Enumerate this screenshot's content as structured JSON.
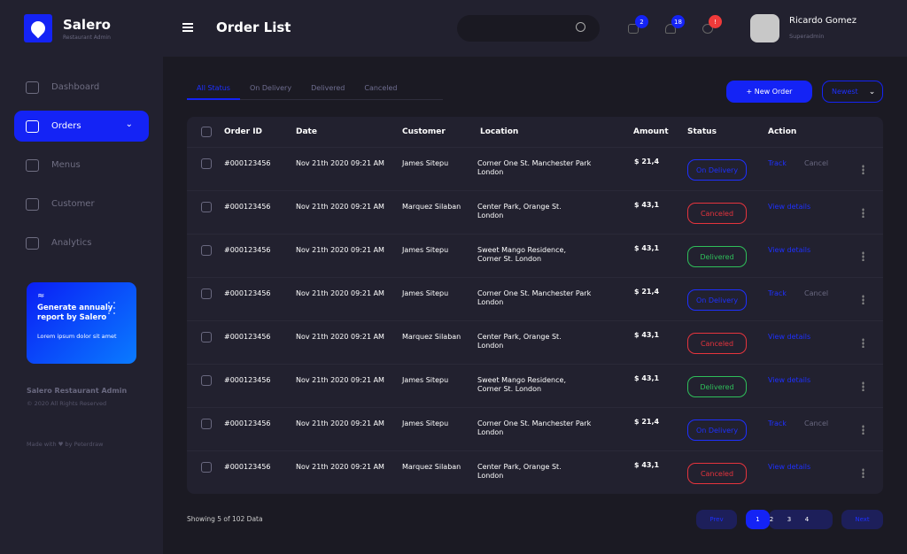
{
  "brand": {
    "name": "Salero",
    "subtitle": "Restaurant Admin"
  },
  "sidebar": {
    "items": [
      {
        "label": "Dashboard",
        "icon": "home-icon"
      },
      {
        "label": "Orders",
        "icon": "orders-icon",
        "active": true
      },
      {
        "label": "Menus",
        "icon": "menus-icon"
      },
      {
        "label": "Customer",
        "icon": "customer-icon"
      },
      {
        "label": "Analytics",
        "icon": "analytics-icon"
      }
    ],
    "promo": {
      "title": "Generate annualy report by Salero",
      "subtitle": "Lorem ipsum dolor sit amet"
    },
    "footer": {
      "name": "Salero Restaurant Admin",
      "copyright": "© 2020 All Rights Reserved",
      "credit": "Made with ♥ by Peterdraw"
    }
  },
  "header": {
    "title": "Order List",
    "search_placeholder": "",
    "messages_count": "2",
    "notifications_count": "18",
    "settings_alert": "!",
    "user": {
      "name": "Ricardo Gomez",
      "role": "Superadmin"
    }
  },
  "tabs": [
    {
      "label": "All Status",
      "active": true
    },
    {
      "label": "On Delivery"
    },
    {
      "label": "Delivered"
    },
    {
      "label": "Canceled"
    }
  ],
  "actions": {
    "new_order": "+ New Order",
    "sort": "Newest"
  },
  "colors": {
    "accent": "#1423f5",
    "on_delivery": "#1e30ff",
    "canceled": "#e5343d",
    "delivered": "#2fbf5a"
  },
  "table": {
    "columns": [
      "Order ID",
      "Date",
      "Customer",
      "Location",
      "Amount",
      "Status",
      "Action"
    ],
    "rows": [
      {
        "id": "#000123456",
        "date": "Nov 21th 2020 09:21 AM",
        "customer": "James Sitepu",
        "loc1": "Corner One St. Manchester Park",
        "loc2": "London",
        "amount": "$ 21,4",
        "status": "On Delivery",
        "action1": "Track",
        "action2": "Cancel"
      },
      {
        "id": "#000123456",
        "date": "Nov 21th 2020 09:21 AM",
        "customer": "Marquez Silaban",
        "loc1": "Center Park, Orange St.",
        "loc2": "London",
        "amount": "$ 43,1",
        "status": "Canceled",
        "action1": "View details",
        "action2": ""
      },
      {
        "id": "#000123456",
        "date": "Nov 21th 2020 09:21 AM",
        "customer": "James Sitepu",
        "loc1": "Sweet Mango Residence,",
        "loc2": "Corner St. London",
        "amount": "$ 43,1",
        "status": "Delivered",
        "action1": "View details",
        "action2": ""
      },
      {
        "id": "#000123456",
        "date": "Nov 21th 2020 09:21 AM",
        "customer": "James Sitepu",
        "loc1": "Corner One St. Manchester Park",
        "loc2": "London",
        "amount": "$ 21,4",
        "status": "On Delivery",
        "action1": "Track",
        "action2": "Cancel"
      },
      {
        "id": "#000123456",
        "date": "Nov 21th 2020 09:21 AM",
        "customer": "Marquez Silaban",
        "loc1": "Center Park, Orange St.",
        "loc2": "London",
        "amount": "$ 43,1",
        "status": "Canceled",
        "action1": "View details",
        "action2": ""
      },
      {
        "id": "#000123456",
        "date": "Nov 21th 2020 09:21 AM",
        "customer": "James Sitepu",
        "loc1": "Sweet Mango Residence,",
        "loc2": "Corner St. London",
        "amount": "$ 43,1",
        "status": "Delivered",
        "action1": "View details",
        "action2": ""
      },
      {
        "id": "#000123456",
        "date": "Nov 21th 2020 09:21 AM",
        "customer": "James Sitepu",
        "loc1": "Corner One St. Manchester Park",
        "loc2": "London",
        "amount": "$ 21,4",
        "status": "On Delivery",
        "action1": "Track",
        "action2": "Cancel"
      },
      {
        "id": "#000123456",
        "date": "Nov 21th 2020 09:21 AM",
        "customer": "Marquez Silaban",
        "loc1": "Center Park, Orange St.",
        "loc2": "London",
        "amount": "$ 43,1",
        "status": "Canceled",
        "action1": "View details",
        "action2": ""
      }
    ]
  },
  "pagination": {
    "showing": "Showing 5 of 102 Data",
    "prev": "Prev",
    "pages": [
      "1",
      "2",
      "3",
      "4"
    ],
    "current": "1",
    "next": "Next"
  }
}
